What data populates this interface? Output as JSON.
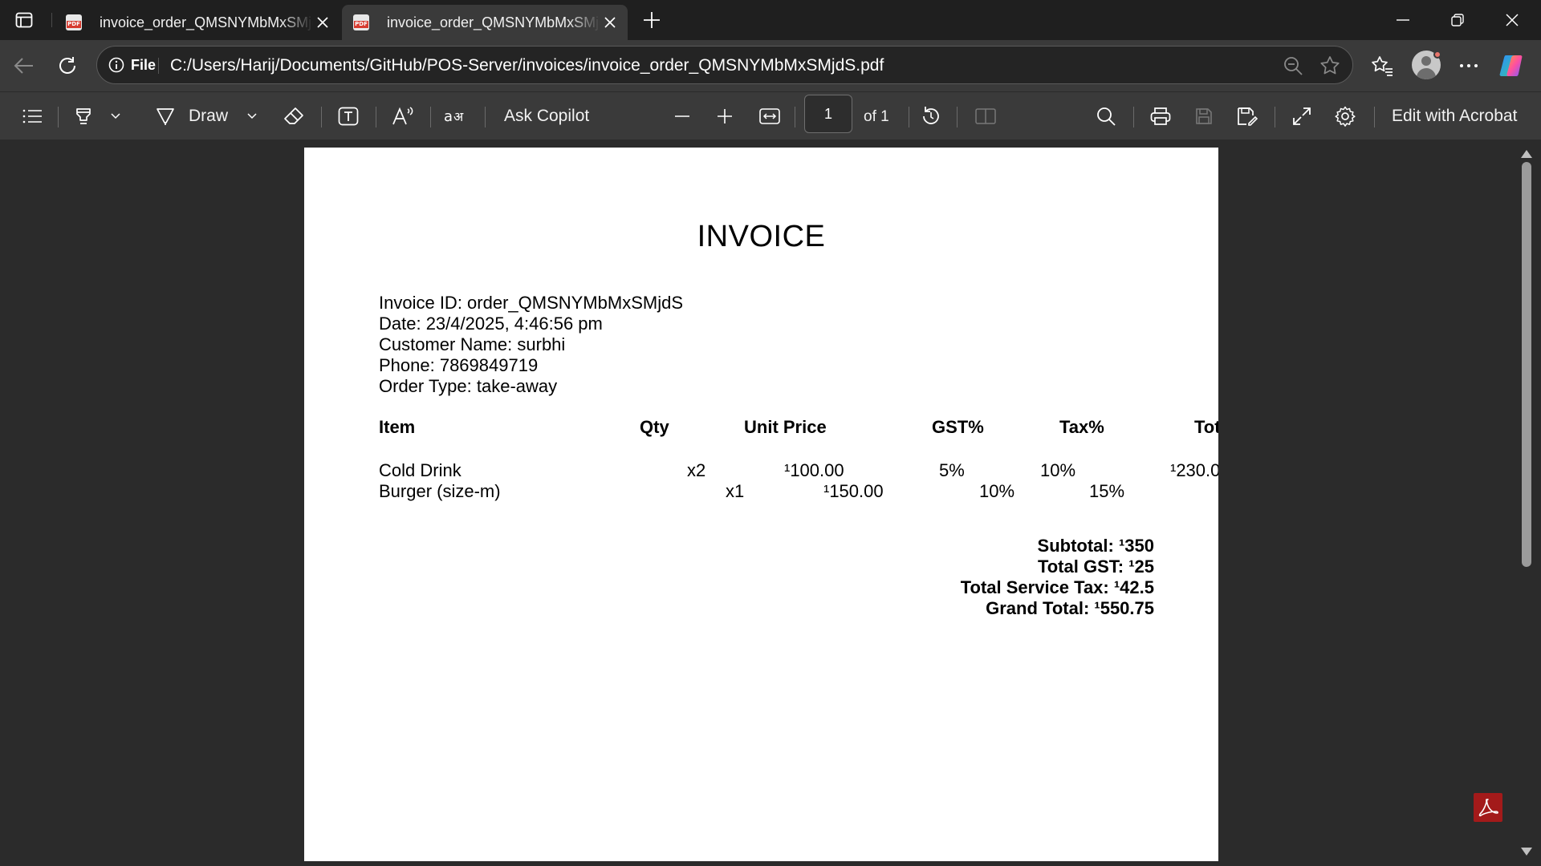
{
  "tabs": [
    {
      "title": "invoice_order_QMSNYMbMxSMjdS.pdf",
      "icon": "pdf-icon",
      "active": false
    },
    {
      "title": "invoice_order_QMSNYMbMxSMjdS.pdf",
      "icon": "pdf-icon",
      "active": true
    }
  ],
  "address": {
    "site_label": "File",
    "url": "C:/Users/Harij/Documents/GitHub/POS-Server/invoices/invoice_order_QMSNYMbMxSMjdS.pdf"
  },
  "pdf_toolbar": {
    "draw_label": "Draw",
    "ask_copilot_label": "Ask Copilot",
    "page_number": "1",
    "page_total": "of 1",
    "edit_acrobat_label": "Edit with Acrobat"
  },
  "invoice": {
    "title": "INVOICE",
    "info": [
      "Invoice ID: order_QMSNYMbMxSMjdS",
      "Date: 23/4/2025, 4:46:56 pm",
      "Customer Name: surbhi",
      "Phone: 7869849719",
      "Order Type: take-away"
    ],
    "columns": [
      "Item",
      "Qty",
      "Unit Price",
      "GST%",
      "Tax%",
      "Tot"
    ],
    "rows": [
      {
        "item": "Cold Drink",
        "qty": "x2",
        "unit_price": "¹100.00",
        "gst": "5%",
        "tax": "10%",
        "total": "¹230.0"
      },
      {
        "item": "Burger (size-m)",
        "qty": "x1",
        "unit_price": "¹150.00",
        "gst": "10%",
        "tax": "15%",
        "total": ""
      }
    ],
    "totals": [
      "Subtotal:  ¹350",
      "Total GST:  ¹25",
      "Total Service Tax:  ¹42.5",
      "Grand Total:  ¹550.75"
    ]
  },
  "colors": {
    "tabstrip_bg": "#1f1f1f",
    "toolbar_bg": "#3a3a3a",
    "viewer_bg": "#2b2b2b",
    "acrobat_red": "#a31a1a",
    "pdf_badge_red": "#d63b2f"
  }
}
